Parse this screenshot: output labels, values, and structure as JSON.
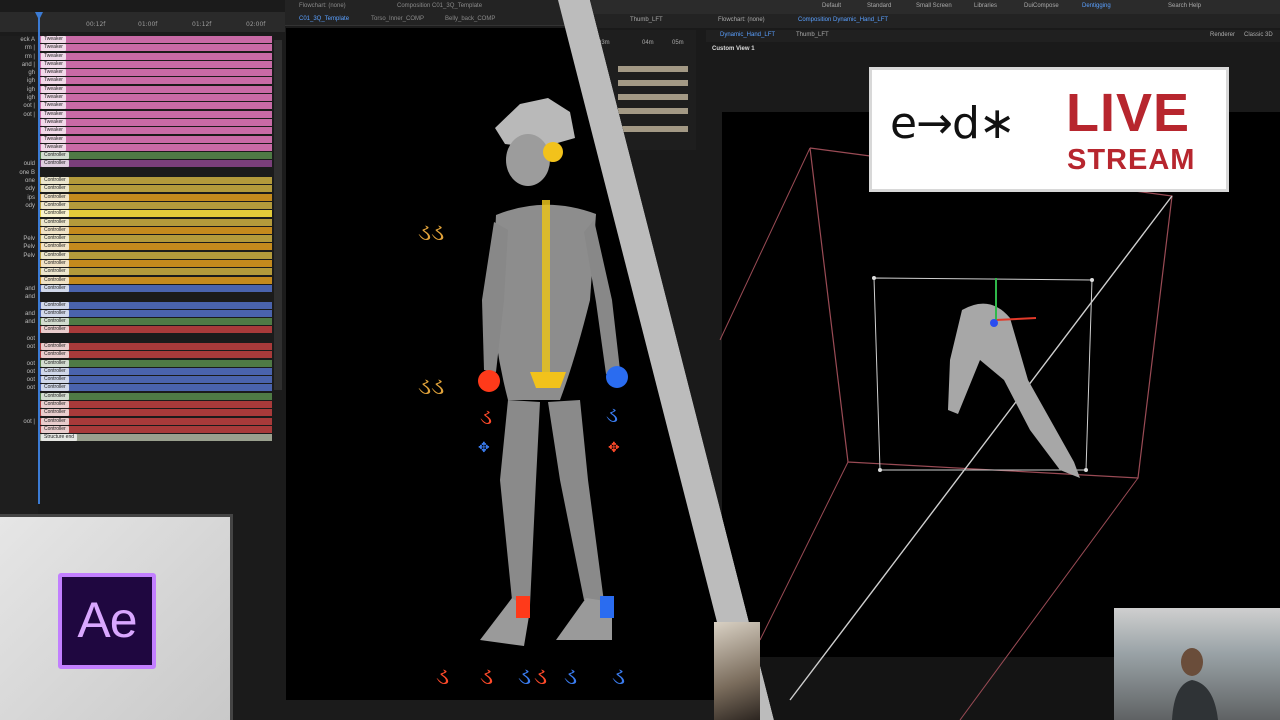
{
  "timeline": {
    "ruler_ticks": [
      "00:12f",
      "01:00f",
      "01:12f",
      "02:00f"
    ],
    "layer_names": [
      "eck A",
      "rm |",
      "rm |",
      "and |",
      "gh",
      "igh",
      "igh",
      "igh",
      "oot |",
      "oot |",
      "",
      "",
      "",
      "",
      "",
      "ould",
      "one B",
      "one",
      "ody",
      "ips",
      "ody",
      "",
      "",
      "",
      "Pelv",
      "Pelv",
      "Pelv",
      "",
      "",
      "",
      "and",
      "and",
      "",
      "and",
      "and",
      "",
      "oot",
      "oot",
      "",
      "oot",
      "oot",
      "oot",
      "oot",
      "",
      "",
      "",
      "oot |"
    ],
    "bars": [
      {
        "color": "#c86aa6",
        "label": "Tweaker"
      },
      {
        "color": "#c86aa6",
        "label": "Tweaker"
      },
      {
        "color": "#c86aa6",
        "label": "Tweaker"
      },
      {
        "color": "#c86aa6",
        "label": "Tweaker"
      },
      {
        "color": "#c86aa6",
        "label": "Tweaker"
      },
      {
        "color": "#c86aa6",
        "label": "Tweaker"
      },
      {
        "color": "#c86aa6",
        "label": "Tweaker"
      },
      {
        "color": "#c86aa6",
        "label": "Tweaker"
      },
      {
        "color": "#c86aa6",
        "label": "Tweaker"
      },
      {
        "color": "#c86aa6",
        "label": "Tweaker"
      },
      {
        "color": "#c86aa6",
        "label": "Tweaker"
      },
      {
        "color": "#c86aa6",
        "label": "Tweaker"
      },
      {
        "color": "#c86aa6",
        "label": "Tweaker"
      },
      {
        "color": "#c86aa6",
        "label": "Tweaker"
      },
      {
        "color": "#4f7a45",
        "label": "Controller"
      },
      {
        "color": "#7b3f7b",
        "label": "Controller"
      },
      {
        "color": "#1b1b1b",
        "label": ""
      },
      {
        "color": "#b39a3b",
        "label": "Controller"
      },
      {
        "color": "#b39a3b",
        "label": "Controller"
      },
      {
        "color": "#c48a1d",
        "label": "Controller"
      },
      {
        "color": "#b39a3b",
        "label": "Controller"
      },
      {
        "color": "#e3cb39",
        "label": "Controller"
      },
      {
        "color": "#b39a3b",
        "label": "Controller"
      },
      {
        "color": "#c48a1d",
        "label": "Controller"
      },
      {
        "color": "#b39a3b",
        "label": "Controller"
      },
      {
        "color": "#c48a1d",
        "label": "Controller"
      },
      {
        "color": "#b39a3b",
        "label": "Controller"
      },
      {
        "color": "#c48a1d",
        "label": "Controller"
      },
      {
        "color": "#b39a3b",
        "label": "Controller"
      },
      {
        "color": "#c48a1d",
        "label": "Controller"
      },
      {
        "color": "#4a63ad",
        "label": "Controller"
      },
      {
        "color": "#1b1b1b",
        "label": ""
      },
      {
        "color": "#4a63ad",
        "label": "Controller"
      },
      {
        "color": "#4a63ad",
        "label": "Controller"
      },
      {
        "color": "#4f7a45",
        "label": "Controller"
      },
      {
        "color": "#a83a3a",
        "label": "Controller"
      },
      {
        "color": "#1b1b1b",
        "label": ""
      },
      {
        "color": "#a83a3a",
        "label": "Controller"
      },
      {
        "color": "#a83a3a",
        "label": "Controller"
      },
      {
        "color": "#4f7a45",
        "label": "Controller"
      },
      {
        "color": "#4a63ad",
        "label": "Controller"
      },
      {
        "color": "#4a63ad",
        "label": "Controller"
      },
      {
        "color": "#4a63ad",
        "label": "Controller"
      },
      {
        "color": "#4f7a45",
        "label": "Controller"
      },
      {
        "color": "#a83a3a",
        "label": "Controller"
      },
      {
        "color": "#a83a3a",
        "label": "Controller"
      },
      {
        "color": "#a83a3a",
        "label": "Controller"
      },
      {
        "color": "#a83a3a",
        "label": "Controller"
      },
      {
        "color": "#9aa08e",
        "label": "Structure end"
      }
    ]
  },
  "composition": {
    "panel_title": "Flowchart: (none)",
    "tabs": [
      "Composition C01_3Q_Template",
      "Torso_Inner_COMP",
      "Belly_back_COMP"
    ],
    "active_subtab": "C01_3Q_Template"
  },
  "right_panel": {
    "menu": [
      "Default",
      "Standard",
      "Small Screen",
      "Libraries",
      "DuiCompose",
      "Dentigging"
    ],
    "active_menu": "Dentigging",
    "search_placeholder": "Search Help",
    "panel_tabs": [
      "Flowchart: (none)",
      "Composition Dynamic_Hand_LFT",
      "Thumb_LFT"
    ],
    "view_tabs": [
      "Dynamic_Hand_LFT",
      "Thumb_LFT"
    ],
    "renderer_label": "Renderer",
    "renderer_value": "Classic 3D",
    "view_name": "Custom View 1",
    "mini_ticks": [
      "03m",
      "04m",
      "05m"
    ]
  },
  "logo": {
    "left_part": "e→d∗",
    "live": "LIVE",
    "stream": "STREAM"
  },
  "ae_badge": "Ae",
  "colors": {
    "accent_blue": "#3b7bd4",
    "live_red": "#b7262e",
    "ae_purple": "#c27fff",
    "ae_bg": "#1f0740"
  }
}
